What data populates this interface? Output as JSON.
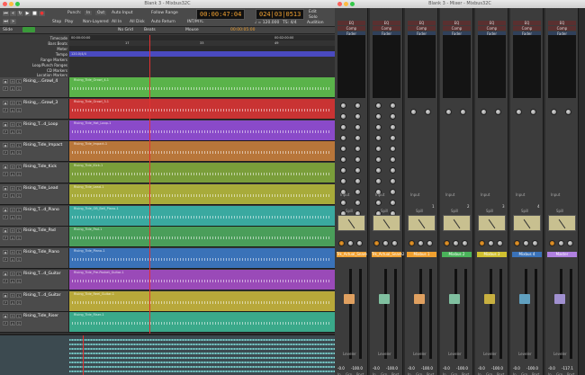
{
  "editor": {
    "title": "Blank 3 - Mixbus32C",
    "toolbar": {
      "punch_label": "Punch:",
      "in_label": "In",
      "out_label": "Out",
      "auto_input": "Auto Input",
      "follow_range": "Follow Range",
      "stop": "Stop",
      "play": "Play",
      "non_layered": "Non-Layered",
      "all_in": "All In",
      "all_disk": "All Disk",
      "auto_return": "Auto Return",
      "int_mtc": "INT/MTC",
      "primary_clock": "00:00:47:04",
      "secondary_clock": "024|03|0513",
      "tempo": "♩ = 120.000",
      "ts": "TS: 4/4",
      "edit_btns": "Edit",
      "solo": "Solo",
      "audition": "Audition",
      "feedback": "Feedback"
    },
    "toolbar2": {
      "mode": "Slide",
      "grid": "No Grid",
      "beats": "Beats",
      "mouse": "Mouse",
      "nudge": "00:00:05:00"
    },
    "rulers": [
      "Timecode",
      "Bars:Beats",
      "Meter",
      "Tempo",
      "Range Markers",
      "Loop/Punch Ranges",
      "CD Markers",
      "Location Markers"
    ],
    "timecode_left": "00:00:00:00",
    "timecode_right": "00:02:00:00",
    "tempo_marker": "120.0/4/4",
    "bars": [
      "17",
      "33",
      "49"
    ],
    "tracks": [
      {
        "name": "Rising_...Growl_4",
        "region": "Rising_Tide_Growl_4-1",
        "color": "#5ab34a"
      },
      {
        "name": "Rising_...Growl_3",
        "region": "Rising_Tide_Growl_3-1",
        "color": "#c93333"
      },
      {
        "name": "Rising_T...d_Loop",
        "region": "Rising_Tide_Hat_Loop-1",
        "color": "#8a4ac9"
      },
      {
        "name": "Rising_Tide_Impact",
        "region": "Rising_Tide_Impact-1",
        "color": "#b8763a"
      },
      {
        "name": "Rising_Tide_Kick",
        "region": "Rising_Tide_Kick-1",
        "color": "#7a9e3a"
      },
      {
        "name": "Rising_Tide_Lead",
        "region": "Rising_Tide_Lead-1",
        "color": "#a8ab3a"
      },
      {
        "name": "Rising_T...d_Piano",
        "region": "Rising_Tide_OB_Bell_Piano-1",
        "color": "#3aa9a0"
      },
      {
        "name": "Rising_Tide_Pad",
        "region": "Rising_Tide_Pad-1",
        "color": "#4a9e5a"
      },
      {
        "name": "Rising_Tide_Piano",
        "region": "Rising_Tide_Piano-1",
        "color": "#3a72b8"
      },
      {
        "name": "Rising_T...d_Guitar",
        "region": "Rising_Tide_Pre-Pocket_Guitar-1",
        "color": "#9a4ab8"
      },
      {
        "name": "Rising_T...d_Guitar",
        "region": "Rising_Tide_Reel_Guitar-1",
        "color": "#b8a83a"
      },
      {
        "name": "Rising_Tide_Riser",
        "region": "Rising_Tide_Riser-1",
        "color": "#3aa98a"
      }
    ]
  },
  "mixer": {
    "title": "Blank 3 - Mixer - Mixbus32C",
    "eq": "EQ",
    "comp": "Comp",
    "fader": "Fader",
    "input": "Input",
    "spill": "Spill",
    "leveler": "Leveler",
    "in_label": "In",
    "grp_label": "Grp",
    "post_label": "Post",
    "strips": [
      {
        "name": "Trk_Actual_Snare",
        "color": "#f0a030",
        "cap": "#e0a060",
        "gain": "-0.0",
        "peak": "-100.0"
      },
      {
        "name": "Trk_Actual_Snare2",
        "color": "#f0a030",
        "cap": "#80c0a0",
        "gain": "-0.0",
        "peak": "-100.0"
      },
      {
        "name": "Mixbus 1",
        "color": "#f0a030",
        "cap": "#e0a060",
        "gain": "-0.0",
        "peak": "-100.0"
      },
      {
        "name": "Mixbus 2",
        "color": "#4ab35a",
        "cap": "#80c0a0",
        "gain": "-0.0",
        "peak": "-100.0"
      },
      {
        "name": "Mixbus 3",
        "color": "#d0c030",
        "cap": "#c8b040",
        "gain": "-0.0",
        "peak": "-100.0"
      },
      {
        "name": "Mixbus 4",
        "color": "#3a72b8",
        "cap": "#60a0c0",
        "gain": "-0.0",
        "peak": "-100.0"
      },
      {
        "name": "Master",
        "color": "#b080e0",
        "cap": "#a090d0",
        "gain": "-0.0",
        "peak": "-117.1"
      }
    ],
    "strip_numbers": [
      "",
      "",
      "1",
      "2",
      "3",
      "4",
      ""
    ]
  }
}
